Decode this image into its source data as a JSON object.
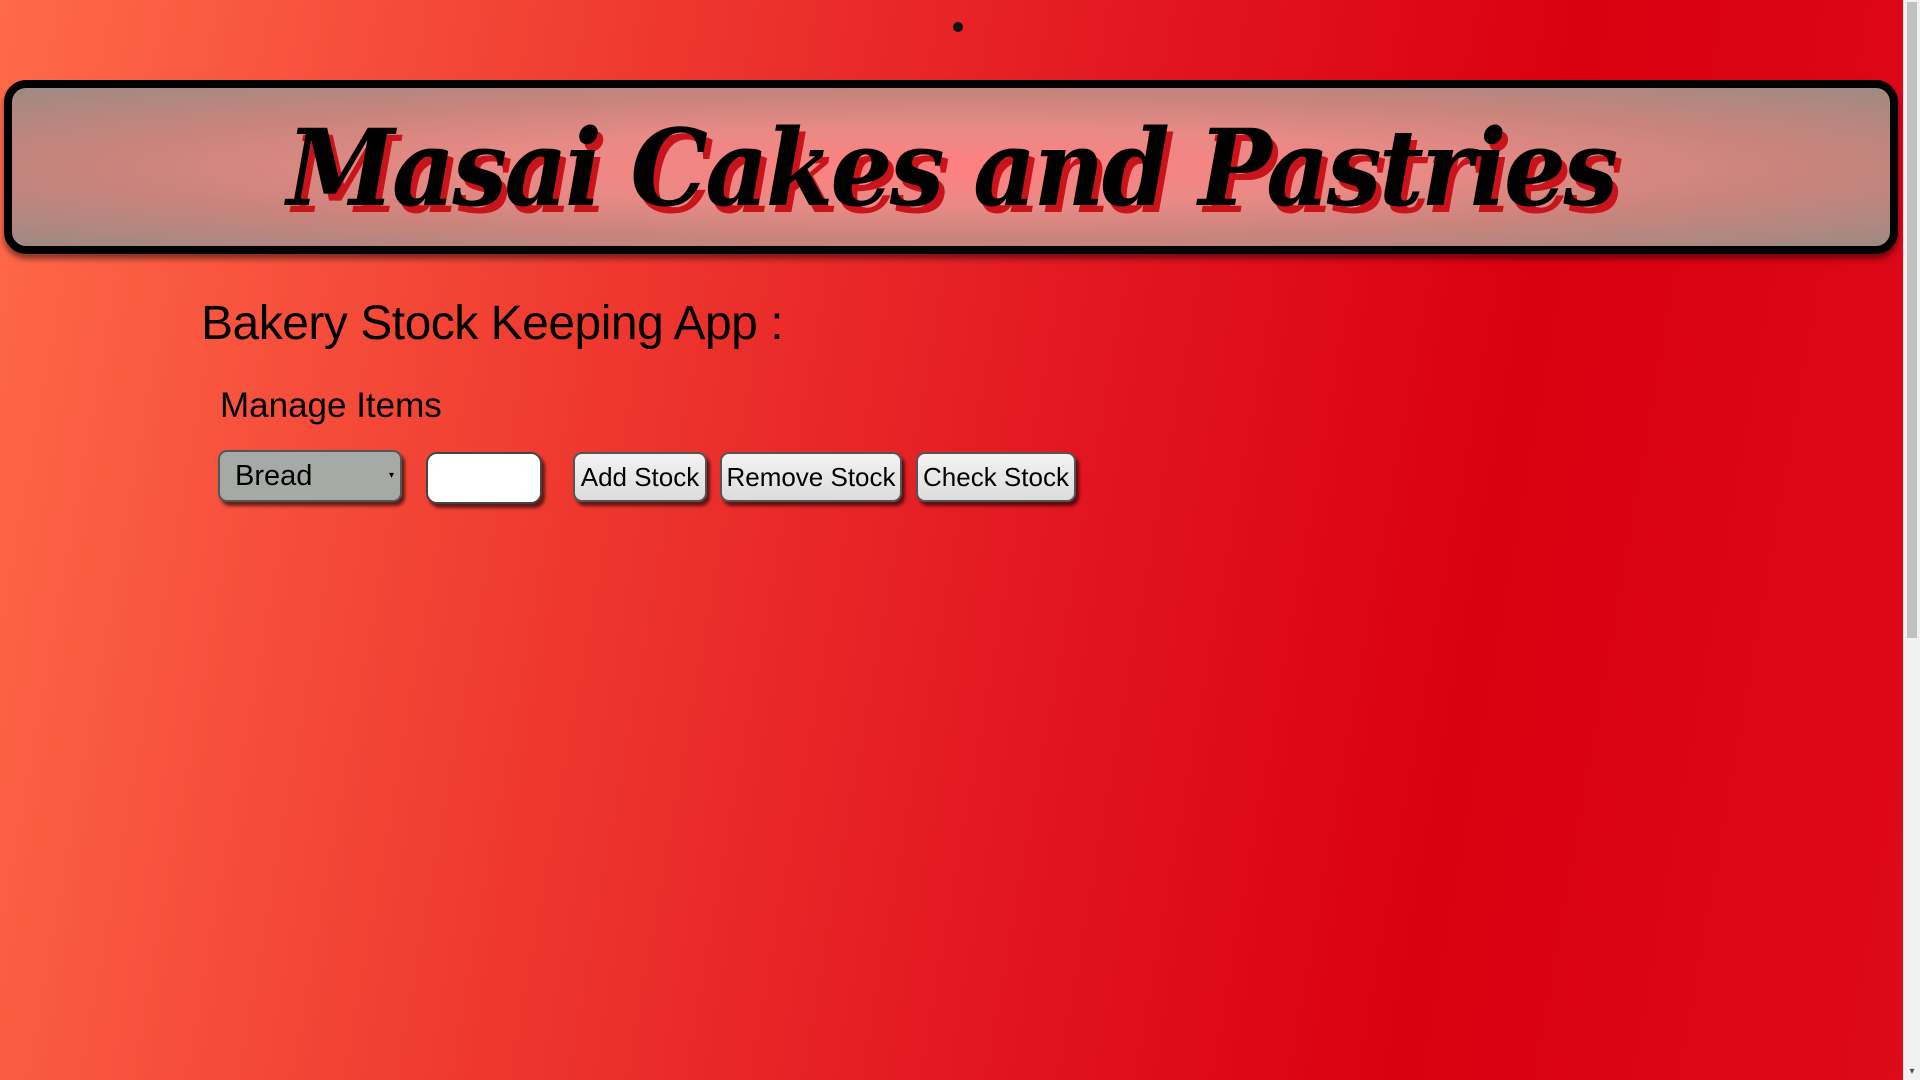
{
  "banner": {
    "title": "Masai Cakes and Pastries"
  },
  "app": {
    "heading": "Bakery Stock Keeping App :",
    "subheading": "Manage Items"
  },
  "controls": {
    "item_select": {
      "selected": "Bread",
      "arrow": "▾"
    },
    "quantity_input": {
      "value": "",
      "placeholder": ""
    },
    "add_label": "Add Stock",
    "remove_label": "Remove Stock",
    "check_label": "Check Stock"
  },
  "scrollbar": {
    "down_arrow": "▾"
  },
  "colors": {
    "background_start": "#ff6a4a",
    "background_end": "#da0010",
    "banner_border": "#000000",
    "title_shadow": "#c8141a",
    "select_bg": "#a6aaa6",
    "button_bg": "#e8e8e8"
  }
}
